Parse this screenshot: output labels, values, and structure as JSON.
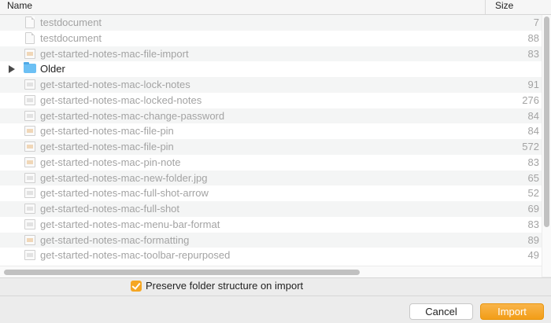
{
  "header": {
    "name_label": "Name",
    "size_label": "Size"
  },
  "rows": [
    {
      "name": "testdocument",
      "size": "7",
      "icon": "document-icon",
      "kind": "doc"
    },
    {
      "name": "testdocument",
      "size": "88",
      "icon": "document-icon",
      "kind": "doc"
    },
    {
      "name": "get-started-notes-mac-file-import",
      "size": "83",
      "icon": "image-file-icon",
      "kind": "img"
    },
    {
      "name": "Older",
      "size": "",
      "icon": "folder-icon",
      "kind": "folder"
    },
    {
      "name": "get-started-notes-mac-lock-notes",
      "size": "91",
      "icon": "image-file-icon",
      "kind": "imggray"
    },
    {
      "name": "get-started-notes-mac-locked-notes",
      "size": "276",
      "icon": "image-file-icon",
      "kind": "imggray"
    },
    {
      "name": "get-started-notes-mac-change-password",
      "size": "84",
      "icon": "image-file-icon",
      "kind": "imggray"
    },
    {
      "name": "get-started-notes-mac-file-pin",
      "size": "84",
      "icon": "image-file-icon",
      "kind": "img"
    },
    {
      "name": "get-started-notes-mac-file-pin",
      "size": "572",
      "icon": "image-file-icon",
      "kind": "img"
    },
    {
      "name": "get-started-notes-mac-pin-note",
      "size": "83",
      "icon": "image-file-icon",
      "kind": "img"
    },
    {
      "name": "get-started-notes-mac-new-folder.jpg",
      "size": "65",
      "icon": "image-file-icon",
      "kind": "imggray"
    },
    {
      "name": "get-started-notes-mac-full-shot-arrow",
      "size": "52",
      "icon": "image-file-icon",
      "kind": "imggray"
    },
    {
      "name": "get-started-notes-mac-full-shot",
      "size": "69",
      "icon": "image-file-icon",
      "kind": "imggray"
    },
    {
      "name": "get-started-notes-mac-menu-bar-format",
      "size": "83",
      "icon": "image-file-icon",
      "kind": "imggray"
    },
    {
      "name": "get-started-notes-mac-formatting",
      "size": "89",
      "icon": "image-file-icon",
      "kind": "img"
    },
    {
      "name": "get-started-notes-mac-toolbar-repurposed",
      "size": "49",
      "icon": "image-file-icon",
      "kind": "imggray"
    }
  ],
  "options": {
    "preserve_label": "Preserve folder structure on import",
    "preserve_checked": true
  },
  "buttons": {
    "cancel_label": "Cancel",
    "import_label": "Import"
  },
  "colors": {
    "accent": "#f29d17",
    "row_alt": "#f4f5f5",
    "disabled_text": "#a3a3a3"
  }
}
